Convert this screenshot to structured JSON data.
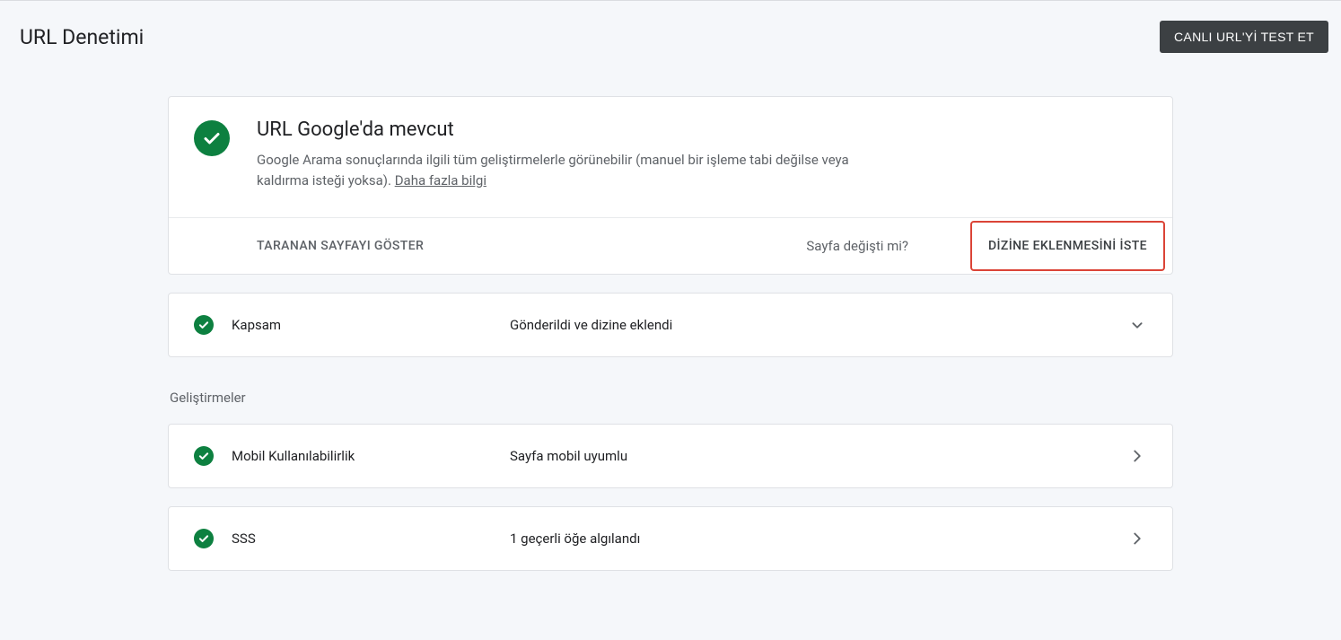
{
  "header": {
    "title": "URL Denetimi",
    "test_button": "CANLI URL'Yİ TEST ET"
  },
  "status": {
    "heading": "URL Google'da mevcut",
    "description_pre": "Google Arama sonuçlarında ilgili tüm geliştirmelerle görünebilir (manuel bir işleme tabi değilse veya kaldırma isteği yoksa). ",
    "learn_more": "Daha fazla bilgi"
  },
  "actions": {
    "view_crawled": "TARANAN SAYFAYI GÖSTER",
    "page_changed": "Sayfa değişti mi?",
    "request_indexing": "DİZİNE EKLENMESİNİ İSTE"
  },
  "coverage": {
    "label": "Kapsam",
    "value": "Gönderildi ve dizine eklendi"
  },
  "enhancements_title": "Geliştirmeler",
  "mobile": {
    "label": "Mobil Kullanılabilirlik",
    "value": "Sayfa mobil uyumlu"
  },
  "faq": {
    "label": "SSS",
    "value": "1 geçerli öğe algılandı"
  }
}
